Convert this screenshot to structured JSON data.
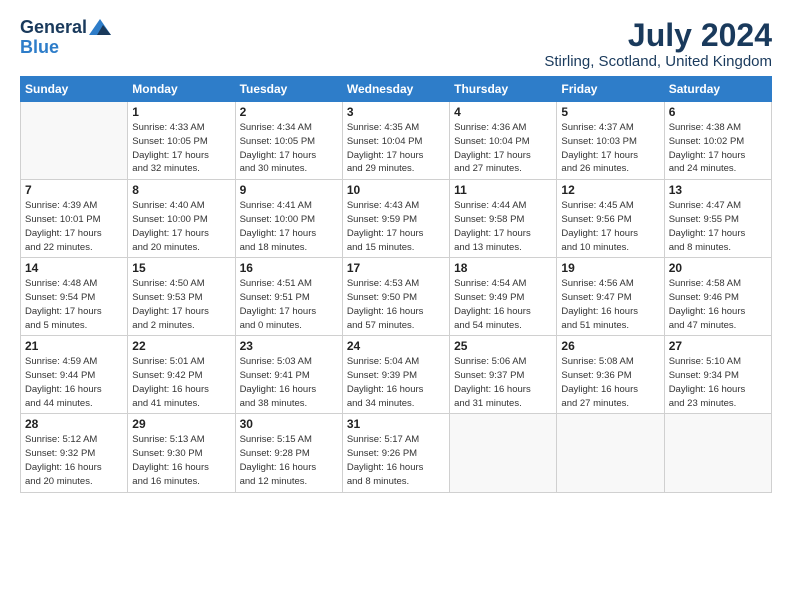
{
  "logo": {
    "general": "General",
    "blue": "Blue"
  },
  "header": {
    "month_year": "July 2024",
    "location": "Stirling, Scotland, United Kingdom"
  },
  "days_of_week": [
    "Sunday",
    "Monday",
    "Tuesday",
    "Wednesday",
    "Thursday",
    "Friday",
    "Saturday"
  ],
  "weeks": [
    [
      {
        "day": "",
        "info": ""
      },
      {
        "day": "1",
        "info": "Sunrise: 4:33 AM\nSunset: 10:05 PM\nDaylight: 17 hours\nand 32 minutes."
      },
      {
        "day": "2",
        "info": "Sunrise: 4:34 AM\nSunset: 10:05 PM\nDaylight: 17 hours\nand 30 minutes."
      },
      {
        "day": "3",
        "info": "Sunrise: 4:35 AM\nSunset: 10:04 PM\nDaylight: 17 hours\nand 29 minutes."
      },
      {
        "day": "4",
        "info": "Sunrise: 4:36 AM\nSunset: 10:04 PM\nDaylight: 17 hours\nand 27 minutes."
      },
      {
        "day": "5",
        "info": "Sunrise: 4:37 AM\nSunset: 10:03 PM\nDaylight: 17 hours\nand 26 minutes."
      },
      {
        "day": "6",
        "info": "Sunrise: 4:38 AM\nSunset: 10:02 PM\nDaylight: 17 hours\nand 24 minutes."
      }
    ],
    [
      {
        "day": "7",
        "info": "Sunrise: 4:39 AM\nSunset: 10:01 PM\nDaylight: 17 hours\nand 22 minutes."
      },
      {
        "day": "8",
        "info": "Sunrise: 4:40 AM\nSunset: 10:00 PM\nDaylight: 17 hours\nand 20 minutes."
      },
      {
        "day": "9",
        "info": "Sunrise: 4:41 AM\nSunset: 10:00 PM\nDaylight: 17 hours\nand 18 minutes."
      },
      {
        "day": "10",
        "info": "Sunrise: 4:43 AM\nSunset: 9:59 PM\nDaylight: 17 hours\nand 15 minutes."
      },
      {
        "day": "11",
        "info": "Sunrise: 4:44 AM\nSunset: 9:58 PM\nDaylight: 17 hours\nand 13 minutes."
      },
      {
        "day": "12",
        "info": "Sunrise: 4:45 AM\nSunset: 9:56 PM\nDaylight: 17 hours\nand 10 minutes."
      },
      {
        "day": "13",
        "info": "Sunrise: 4:47 AM\nSunset: 9:55 PM\nDaylight: 17 hours\nand 8 minutes."
      }
    ],
    [
      {
        "day": "14",
        "info": "Sunrise: 4:48 AM\nSunset: 9:54 PM\nDaylight: 17 hours\nand 5 minutes."
      },
      {
        "day": "15",
        "info": "Sunrise: 4:50 AM\nSunset: 9:53 PM\nDaylight: 17 hours\nand 2 minutes."
      },
      {
        "day": "16",
        "info": "Sunrise: 4:51 AM\nSunset: 9:51 PM\nDaylight: 17 hours\nand 0 minutes."
      },
      {
        "day": "17",
        "info": "Sunrise: 4:53 AM\nSunset: 9:50 PM\nDaylight: 16 hours\nand 57 minutes."
      },
      {
        "day": "18",
        "info": "Sunrise: 4:54 AM\nSunset: 9:49 PM\nDaylight: 16 hours\nand 54 minutes."
      },
      {
        "day": "19",
        "info": "Sunrise: 4:56 AM\nSunset: 9:47 PM\nDaylight: 16 hours\nand 51 minutes."
      },
      {
        "day": "20",
        "info": "Sunrise: 4:58 AM\nSunset: 9:46 PM\nDaylight: 16 hours\nand 47 minutes."
      }
    ],
    [
      {
        "day": "21",
        "info": "Sunrise: 4:59 AM\nSunset: 9:44 PM\nDaylight: 16 hours\nand 44 minutes."
      },
      {
        "day": "22",
        "info": "Sunrise: 5:01 AM\nSunset: 9:42 PM\nDaylight: 16 hours\nand 41 minutes."
      },
      {
        "day": "23",
        "info": "Sunrise: 5:03 AM\nSunset: 9:41 PM\nDaylight: 16 hours\nand 38 minutes."
      },
      {
        "day": "24",
        "info": "Sunrise: 5:04 AM\nSunset: 9:39 PM\nDaylight: 16 hours\nand 34 minutes."
      },
      {
        "day": "25",
        "info": "Sunrise: 5:06 AM\nSunset: 9:37 PM\nDaylight: 16 hours\nand 31 minutes."
      },
      {
        "day": "26",
        "info": "Sunrise: 5:08 AM\nSunset: 9:36 PM\nDaylight: 16 hours\nand 27 minutes."
      },
      {
        "day": "27",
        "info": "Sunrise: 5:10 AM\nSunset: 9:34 PM\nDaylight: 16 hours\nand 23 minutes."
      }
    ],
    [
      {
        "day": "28",
        "info": "Sunrise: 5:12 AM\nSunset: 9:32 PM\nDaylight: 16 hours\nand 20 minutes."
      },
      {
        "day": "29",
        "info": "Sunrise: 5:13 AM\nSunset: 9:30 PM\nDaylight: 16 hours\nand 16 minutes."
      },
      {
        "day": "30",
        "info": "Sunrise: 5:15 AM\nSunset: 9:28 PM\nDaylight: 16 hours\nand 12 minutes."
      },
      {
        "day": "31",
        "info": "Sunrise: 5:17 AM\nSunset: 9:26 PM\nDaylight: 16 hours\nand 8 minutes."
      },
      {
        "day": "",
        "info": ""
      },
      {
        "day": "",
        "info": ""
      },
      {
        "day": "",
        "info": ""
      }
    ]
  ]
}
